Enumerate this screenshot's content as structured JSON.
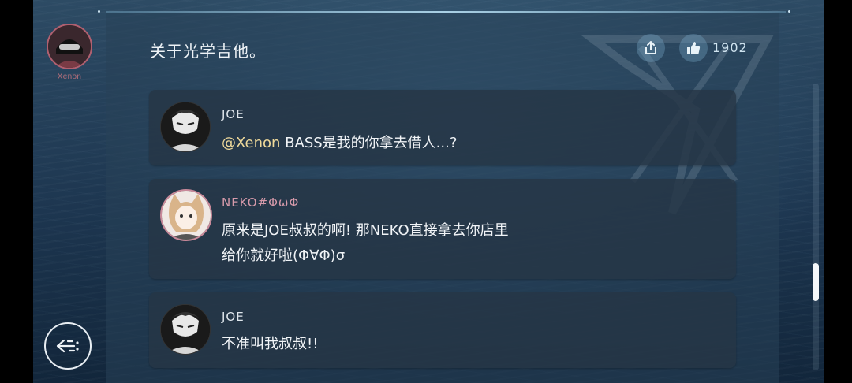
{
  "post": {
    "author": "Xenon",
    "title": "关于光学吉他。",
    "like_count": "1902"
  },
  "actions": {
    "share_icon": "share-icon",
    "like_icon": "thumbs-up-icon",
    "back_icon": "back-arrow-icon"
  },
  "comments": [
    {
      "author": "JOE",
      "mention": "@Xenon",
      "text": " BASS是我的你拿去借人...?",
      "name_color": "#dfe6ec"
    },
    {
      "author": "NEKO#ΦωΦ",
      "lines": [
        "原来是JOE叔叔的啊! 那NEKO直接拿去你店里",
        "给你就好啦(Φ∀Φ)σ"
      ],
      "name_color": "#d69aaa"
    },
    {
      "author": "JOE",
      "text": "不准叫我叔叔!!",
      "name_color": "#dfe6ec"
    }
  ],
  "colors": {
    "mention": "#efd99a",
    "accent_line": "#bfe4f4"
  }
}
